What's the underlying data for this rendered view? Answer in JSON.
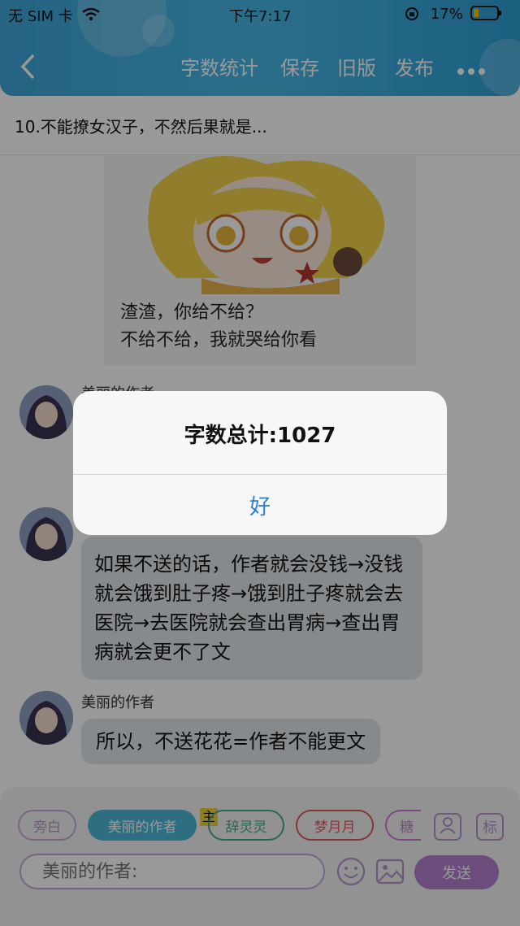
{
  "status_bar": {
    "carrier": "无 SIM 卡",
    "time": "下午7:17",
    "battery": "17%"
  },
  "nav": {
    "back_icon": "chevron-left-icon",
    "actions": [
      "字数统计",
      "保存",
      "旧版",
      "发布"
    ],
    "more_icon": "more-dots-icon"
  },
  "content": {
    "heading": "10.不能撩女汉子，不然后果就是...",
    "sticker_caption_1": "渣渣，你给不给？",
    "sticker_caption_2": "不给不给，我就哭给你看"
  },
  "messages": [
    {
      "speaker": "美丽的作者",
      "text": ""
    },
    {
      "speaker": "",
      "text": "如果不送的话，作者就会没钱→没钱就会饿到肚子疼→饿到肚子疼就会去医院→去医院就会查出胃病→查出胃病就会更不了文"
    },
    {
      "speaker": "美丽的作者",
      "text": "所以，不送花花=作者不能更文"
    }
  ],
  "bottom_bar": {
    "roles": [
      "旁白",
      "美丽的作者",
      "辞灵灵",
      "梦月月",
      "糖"
    ],
    "main_badge": "主",
    "tag_button": "标",
    "input_placeholder": "美丽的作者:",
    "send_label": "发送"
  },
  "alert": {
    "title": "字数总计:1027",
    "ok_label": "好"
  },
  "colors": {
    "header_blue": "#3ea7da",
    "accent_purple": "#b27fd0",
    "chip_blue": "#4db8d8",
    "chip_red": "#e05a5a",
    "chip_green": "#4aa88a",
    "alert_button_blue": "#2f7fd0"
  }
}
